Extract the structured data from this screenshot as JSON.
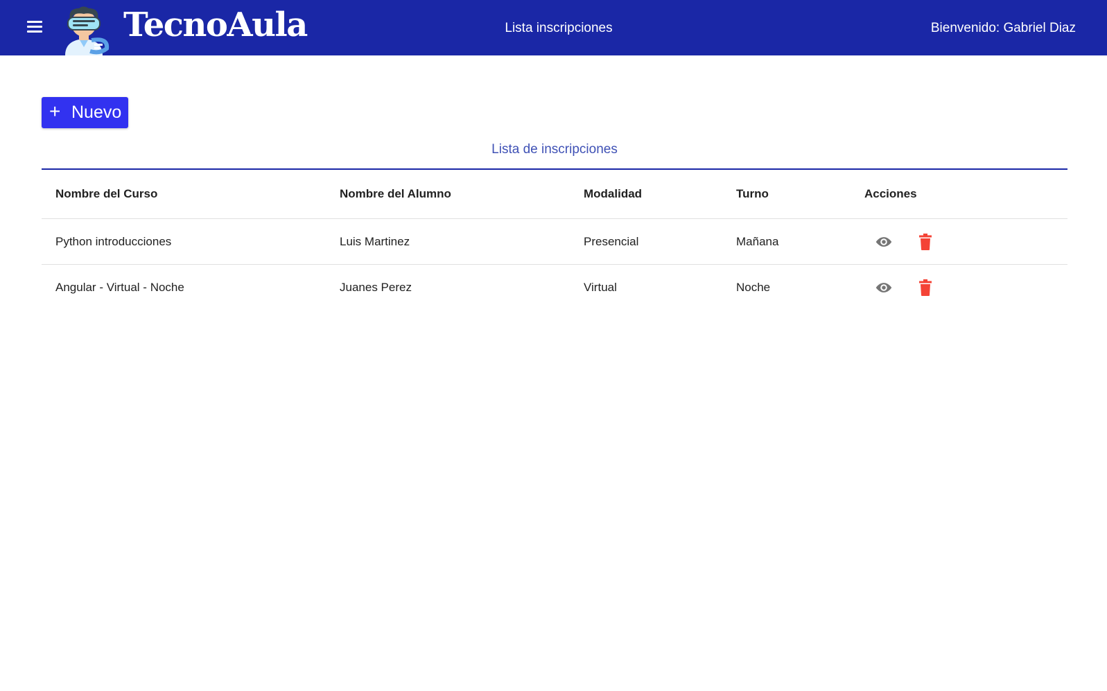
{
  "header": {
    "brand": "TecnoAula",
    "title": "Lista inscripciones",
    "welcome": "Bienvenido: Gabriel Diaz",
    "background": "#1a27a6",
    "menu_icon": "hamburger-menu-icon",
    "logo_icon": "vr-student-mascot-icon"
  },
  "toolbar": {
    "new_icon": "+",
    "new_label": "Nuevo",
    "new_color": "#3232f0"
  },
  "table": {
    "caption": "Lista de inscripciones",
    "columns": [
      "Nombre del Curso",
      "Nombre del Alumno",
      "Modalidad",
      "Turno",
      "Acciones"
    ],
    "rows": [
      {
        "curso": "Python introducciones",
        "alumno": "Luis Martinez",
        "modalidad": "Presencial",
        "turno": "Mañana"
      },
      {
        "curso": "Angular - Virtual - Noche",
        "alumno": "Juanes Perez",
        "modalidad": "Virtual",
        "turno": "Noche"
      }
    ],
    "action_icons": [
      "eye-icon",
      "trash-icon"
    ],
    "delete_color": "#f44336",
    "view_color": "#757575"
  }
}
